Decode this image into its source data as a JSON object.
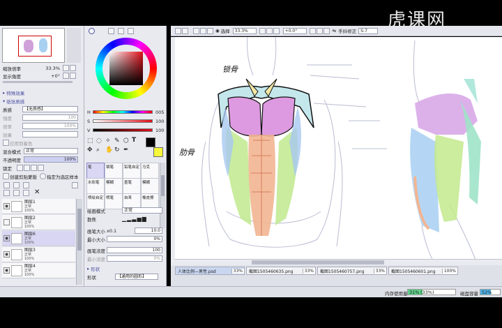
{
  "watermark": "虎课网",
  "navigator": {
    "zoom_label": "缩放倍率",
    "zoom_value": "33.3%",
    "angle_label": "显示角度",
    "angle_value": "+0°"
  },
  "left_panel": {
    "effects_header": "特殊效果",
    "texture_header": "纸张质感",
    "texture_label": "质感",
    "texture_value": "【无质感】",
    "intensity_label": "强度",
    "intensity_value": "100",
    "scale_label": "倍率",
    "scale_value": "100%",
    "effect_label": "效果",
    "use_color_label": "应用到着色",
    "blend_label": "混合模式",
    "blend_value": "正常",
    "opacity_label": "不透明度",
    "opacity_value": "100%",
    "lock_label": "锁定",
    "clip_label": "创建剪贴蒙版",
    "select_source_label": "指定为选区样本",
    "layers": [
      {
        "name": "图层1",
        "mode": "正常",
        "opacity": "100%",
        "selected": false
      },
      {
        "name": "图层2",
        "mode": "正常",
        "opacity": "100%",
        "selected": false
      },
      {
        "name": "图层6",
        "mode": "正常",
        "opacity": "100%",
        "selected": true
      },
      {
        "name": "图层3",
        "mode": "正常",
        "opacity": "100%",
        "selected": false
      },
      {
        "name": "图层4",
        "mode": "正常",
        "opacity": "100%",
        "selected": false
      }
    ]
  },
  "color_panel": {
    "h_label": "H",
    "h_value": "005",
    "s_label": "S",
    "s_value": "100",
    "v_label": "V",
    "v_value": "100",
    "primary_color": "#000000",
    "secondary_color": "#f6f73a",
    "wheel_color": "#8c0a12"
  },
  "tool_panel": {
    "brushes": [
      "笔",
      "钢笔",
      "铅笔自定",
      "马克",
      "水彩笔",
      "模糊",
      "墨笔",
      "模糊",
      "喷绘自定",
      "喷笔",
      "自来",
      "橡皮擦",
      "水彩",
      "笔刷",
      "自定笔刷",
      "自定"
    ],
    "blend_mode_label": "绘画模式",
    "blend_mode_value": "正常",
    "blend_label": "散焦",
    "size_label": "画笔大小",
    "size_mult": "x0.1",
    "size_value": "10.0",
    "min_size_label": "最小大小",
    "min_size_value": "0%",
    "density_label": "画笔浓度",
    "density_value": "100",
    "min_density_label": "最小浓度",
    "min_density_value": "0%",
    "shape_header": "形状",
    "shape_label": "形状",
    "shape_value": "【通用的圆形】"
  },
  "top_toolbar": {
    "select_label": "选择",
    "zoom_value": "33.3%",
    "angle_value": "+0.0°",
    "stabilizer_label": "手抖修正",
    "stabilizer_value": "S-7"
  },
  "annotations": {
    "clavicle": "锁骨",
    "ribs": "肋骨"
  },
  "tabs": [
    {
      "label": "人体比例—男性.psd",
      "pct": "33%"
    },
    {
      "label": "截图1505460635.png",
      "pct": "33%"
    },
    {
      "label": "截图1505460757.png",
      "pct": "33%"
    },
    {
      "label": "截图1505460601.png",
      "pct": "100%"
    }
  ],
  "status": {
    "memory_label": "内存使用量",
    "memory_value": "31%",
    "memory_value2": "(33%)",
    "disk_label": "磁盘容量",
    "disk_value": "52%"
  }
}
